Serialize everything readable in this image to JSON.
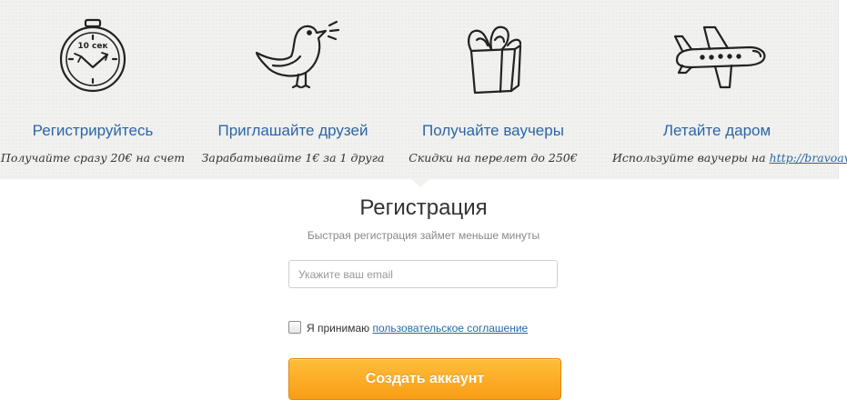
{
  "steps": [
    {
      "icon": "stopwatch-icon",
      "clock_text": "10 сек",
      "title": "Регистрируйтесь",
      "subtitle": "Получайте сразу 20€ на счет"
    },
    {
      "icon": "bird-icon",
      "title": "Приглашайте друзей",
      "subtitle": "Зарабатывайте 1€ за 1 друга"
    },
    {
      "icon": "gift-box-icon",
      "title": "Получайте ваучеры",
      "subtitle": "Скидки на перелет до 250€"
    },
    {
      "icon": "airplane-icon",
      "title": "Летайте даром",
      "subtitle": "Используйте ваучеры на",
      "subtitle_link": "http://bravoavia.ru"
    }
  ],
  "registration": {
    "title": "Регистрация",
    "subtitle": "Быстрая регистрация займет меньше минуты",
    "email_placeholder": "Укажите ваш email",
    "email_value": "",
    "agree_checked": false,
    "agree_text": "Я принимаю",
    "agree_link": "пользовательское соглашение",
    "submit_label": "Создать аккаунт"
  },
  "colors": {
    "link": "#2b66a6",
    "banner_bg": "#f1f1ef",
    "button_top": "#ffbe3a",
    "button_bottom": "#f99d16"
  }
}
